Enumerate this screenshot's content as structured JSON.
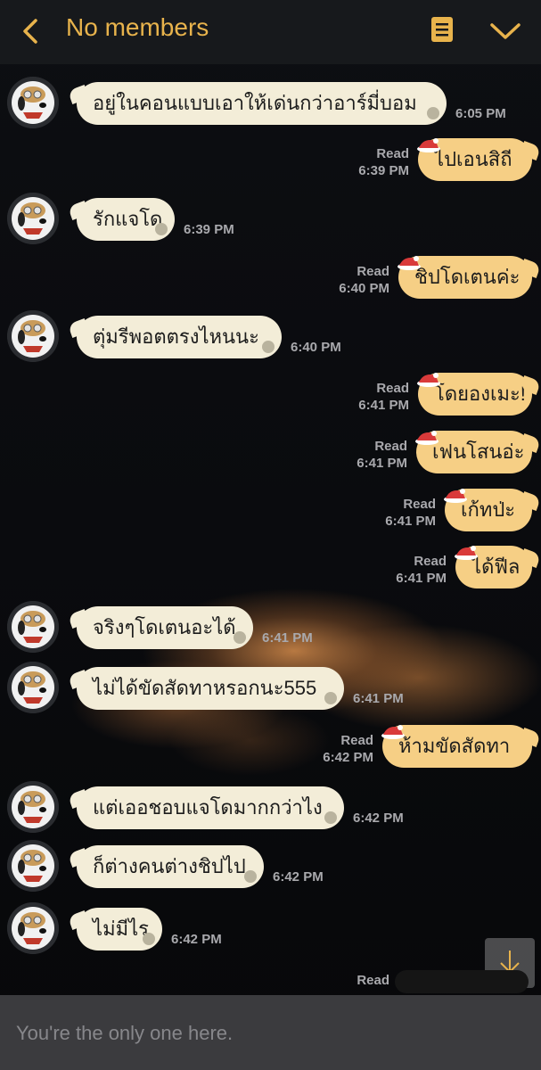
{
  "header": {
    "title": "No members",
    "icons": [
      "back-arrow-icon",
      "menu-list-icon",
      "chevron-down-icon"
    ],
    "accent_color": "#e8b34c"
  },
  "messages": [
    {
      "side": "left",
      "text": "อยู่ในคอนแบบเอาให้เด่นกว่าอาร์มี่บอม",
      "time": "6:05 PM"
    },
    {
      "side": "right",
      "text": "ไปเอนสิถี",
      "read": "Read",
      "time": "6:39 PM"
    },
    {
      "side": "left",
      "text": "รักแจโด",
      "time": "6:39 PM"
    },
    {
      "side": "right",
      "text": "ชิปโดเตนค่ะ",
      "read": "Read",
      "time": "6:40 PM"
    },
    {
      "side": "left",
      "text": "ตุ่มรีพอตตรงไหนนะ",
      "time": "6:40 PM"
    },
    {
      "side": "right",
      "text": "โดยองเมะ!",
      "read": "Read",
      "time": "6:41 PM"
    },
    {
      "side": "right",
      "text": "เฟนโสนอ่ะ",
      "read": "Read",
      "time": "6:41 PM"
    },
    {
      "side": "right",
      "text": "เก้ทป่ะ",
      "read": "Read",
      "time": "6:41 PM"
    },
    {
      "side": "right",
      "text": "ได้ฟีล",
      "read": "Read",
      "time": "6:41 PM"
    },
    {
      "side": "left",
      "text": "จริงๆโดเตนอะได้",
      "time": "6:41 PM"
    },
    {
      "side": "left",
      "text": "ไม่ได้ขัดสัดทาหรอกนะ555",
      "time": "6:41 PM"
    },
    {
      "side": "right",
      "text": "ห้ามขัดสัดทา",
      "read": "Read",
      "time": "6:42 PM"
    },
    {
      "side": "left",
      "text": "แต่เออชอบแจโดมากกว่าไง",
      "time": "6:42 PM"
    },
    {
      "side": "left",
      "text": "ก็ต่างคนต่างชิปไป",
      "time": "6:42 PM"
    },
    {
      "side": "left",
      "text": "ไม่มีไร",
      "time": "6:42 PM"
    },
    {
      "side": "right",
      "text": "",
      "read": "Read",
      "time": ""
    }
  ],
  "footer": {
    "placeholder": "You're the only one here."
  },
  "colors": {
    "left_bubble": "#f3edd8",
    "right_bubble": "#f6cf85",
    "meta_text": "#a9a9ad"
  }
}
